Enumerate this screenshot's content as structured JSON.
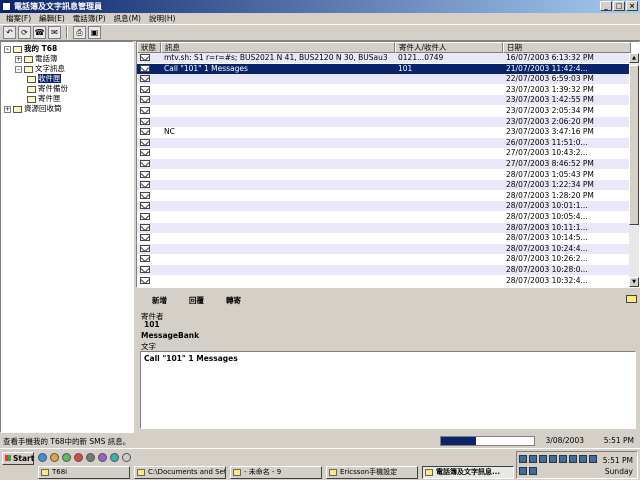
{
  "window": {
    "title": "電話簿及文字訊息管理員"
  },
  "menu": [
    "檔案(F)",
    "編輯(E)",
    "電話簿(P)",
    "訊息(M)",
    "說明(H)"
  ],
  "toolbar": {
    "buttons": [
      "undo-icon",
      "refresh-icon",
      "phonebook-icon",
      "sms-icon",
      "print-icon",
      "save-icon"
    ]
  },
  "tree": {
    "root": "我的 T68",
    "phonebook": "電話簿",
    "sms": "文字訊息",
    "inbox": "收件匣",
    "outbox_backup": "寄件備份",
    "outbox": "寄件匣",
    "recycle": "資源回收筒"
  },
  "list": {
    "columns": [
      "狀態",
      "訊息",
      "寄件人/收件人",
      "日期"
    ],
    "rows": [
      {
        "message": "mtv.sh: S1 r=r=#s; BUS2021 N 41, BUS2120 N 30, BUSau3",
        "sender": "0121...0749",
        "date": "16/07/2003 6:13:32 PM"
      },
      {
        "message": "Call \"101\" 1 Messages",
        "sender": "101",
        "date": "21/07/2003 11:42:4..."
      },
      {
        "message": "",
        "sender": "",
        "date": "22/07/2003 6:59:03 PM"
      },
      {
        "message": "",
        "sender": "",
        "date": "23/07/2003 1:39:32 PM"
      },
      {
        "message": "",
        "sender": "",
        "date": "23/07/2003 1:42:55 PM"
      },
      {
        "message": "",
        "sender": "",
        "date": "23/07/2003 2:05:34 PM"
      },
      {
        "message": "",
        "sender": "",
        "date": "23/07/2003 2:06:20 PM"
      },
      {
        "message": "NC",
        "sender": "",
        "date": "23/07/2003 3:47:16 PM"
      },
      {
        "message": "",
        "sender": "",
        "date": "26/07/2003 11:51:0..."
      },
      {
        "message": "",
        "sender": "",
        "date": "27/07/2003 10:43:2..."
      },
      {
        "message": "",
        "sender": "",
        "date": "27/07/2003 8:46:52 PM"
      },
      {
        "message": "",
        "sender": "",
        "date": "28/07/2003 1:05:43 PM"
      },
      {
        "message": "",
        "sender": "",
        "date": "28/07/2003 1:22:34 PM"
      },
      {
        "message": "",
        "sender": "",
        "date": "28/07/2003 1:28:20 PM"
      },
      {
        "message": "",
        "sender": "",
        "date": "28/07/2003 10:01:1..."
      },
      {
        "message": "",
        "sender": "",
        "date": "28/07/2003 10:05:4..."
      },
      {
        "message": "",
        "sender": "",
        "date": "28/07/2003 10:11:1..."
      },
      {
        "message": "",
        "sender": "",
        "date": "28/07/2003 10:14:5..."
      },
      {
        "message": "",
        "sender": "",
        "date": "28/07/2003 10:24:4..."
      },
      {
        "message": "",
        "sender": "",
        "date": "28/07/2003 10:26:2..."
      },
      {
        "message": "",
        "sender": "",
        "date": "28/07/2003 10:28:0..."
      },
      {
        "message": "",
        "sender": "",
        "date": "28/07/2003 10:32:4..."
      }
    ],
    "selected_index": 1
  },
  "preview": {
    "actions": [
      "新增",
      "回覆",
      "轉寄"
    ],
    "sender_label": "寄件者",
    "sender_value": "101",
    "sender_name": "MessageBank",
    "text_label": "文字",
    "text": "Call \"101\" 1 Messages"
  },
  "status": {
    "text": "查看手機我的 T68中的新 SMS 訊息。",
    "progress": 0.38,
    "date": "3/08/2003",
    "time": "5:51 PM"
  },
  "taskbar": {
    "start": "Start",
    "buttons": [
      "T68i",
      "C:\\Documents and Sett...",
      "- 未命名 - 9",
      "Ericsson手機設定",
      "電話簿及文字訊息..."
    ],
    "active_index": 4,
    "clock": {
      "time": "5:51 PM",
      "day": "Sunday"
    }
  }
}
